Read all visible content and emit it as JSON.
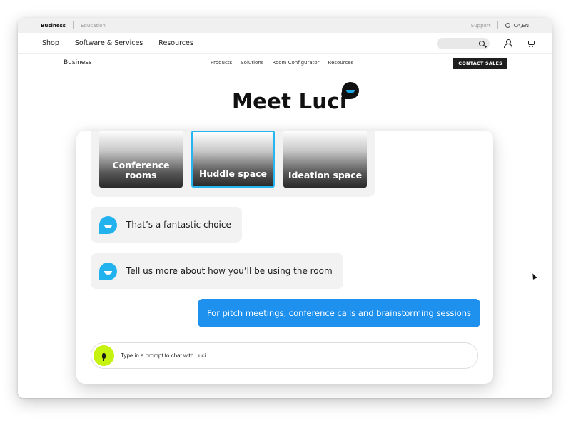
{
  "utility_bar": {
    "segments": [
      "Business",
      "Education"
    ],
    "active_segment": "Business",
    "support_label": "Support",
    "locale_label": "CA,EN"
  },
  "main_nav": {
    "links": [
      "Shop",
      "Software & Services",
      "Resources"
    ],
    "search_placeholder": ""
  },
  "sub_nav": {
    "brand": "Business",
    "links": [
      "Products",
      "Solutions",
      "Room Configurator",
      "Resources"
    ],
    "cta_label": "CONTACT SALES"
  },
  "hero": {
    "title": "Meet Luci"
  },
  "chat": {
    "room_choices": [
      {
        "label": "Conference rooms",
        "selected": false
      },
      {
        "label": "Huddle space",
        "selected": true
      },
      {
        "label": "Ideation space",
        "selected": false
      }
    ],
    "messages": [
      {
        "sender": "bot",
        "text": "That’s a fantastic choice"
      },
      {
        "sender": "bot",
        "text": "Tell us more about how you’ll be using the room"
      },
      {
        "sender": "user",
        "text": "For pitch meetings, conference calls and brainstorming sessions"
      }
    ],
    "prompt_placeholder": "Type in a prompt to chat with Luci",
    "prompt_value": ""
  },
  "colors": {
    "accent_blue": "#1e90ee",
    "luci_blue": "#22b3ef",
    "mic_green": "#c6f20f",
    "cta_dark": "#1e1e1e"
  }
}
